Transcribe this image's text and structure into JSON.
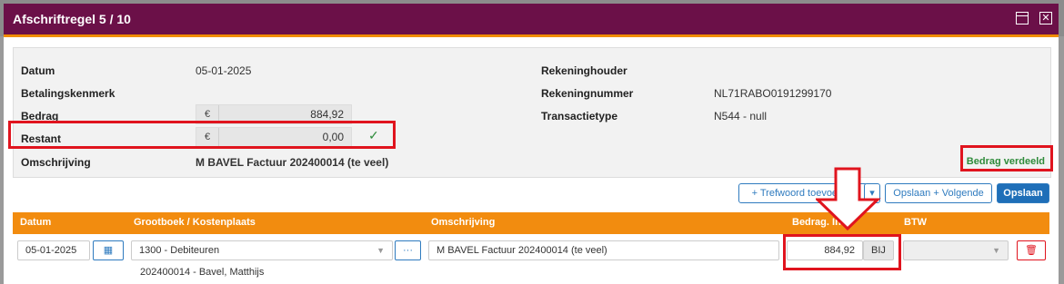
{
  "modal": {
    "title": "Afschriftregel 5 / 10"
  },
  "info": {
    "datum_label": "Datum",
    "datum_value": "05-01-2025",
    "kenmerk_label": "Betalingskenmerk",
    "bedrag_label": "Bedrag",
    "bedrag_currency": "€",
    "bedrag_value": "884,92",
    "restant_label": "Restant",
    "restant_currency": "€",
    "restant_value": "0,00",
    "omschrijving_label": "Omschrijving",
    "omschrijving_value": "M BAVEL Factuur 202400014 (te veel)",
    "houder_label": "Rekeninghouder",
    "nummer_label": "Rekeningnummer",
    "nummer_value": "NL71RABO0191299170",
    "type_label": "Transactietype",
    "type_value": "N544 - null",
    "status": "Bedrag verdeeld"
  },
  "toolbar": {
    "trefwoord_label": "+ Trefwoord toevoegen",
    "opslaan_volgende_label": "Opslaan + Volgende",
    "opslaan_label": "Opslaan"
  },
  "grid": {
    "headers": [
      "Datum",
      "Grootboek / Kostenplaats",
      "Omschrijving",
      "Bedrag. Incl.",
      "BTW"
    ],
    "row": {
      "datum": "05-01-2025",
      "grootboek": "1300 - Debiteuren",
      "omschrijving": "M BAVEL Factuur 202400014 (te veel)",
      "bedrag": "884,92",
      "bij": "BIJ",
      "relatie": "202400014 - Bavel, Matthijs"
    }
  },
  "colors": {
    "titlebar": "#6b1048",
    "accent": "#f28c0f",
    "primary": "#1f6fb8",
    "highlight": "#e0141e",
    "success": "#2e8b3a"
  }
}
